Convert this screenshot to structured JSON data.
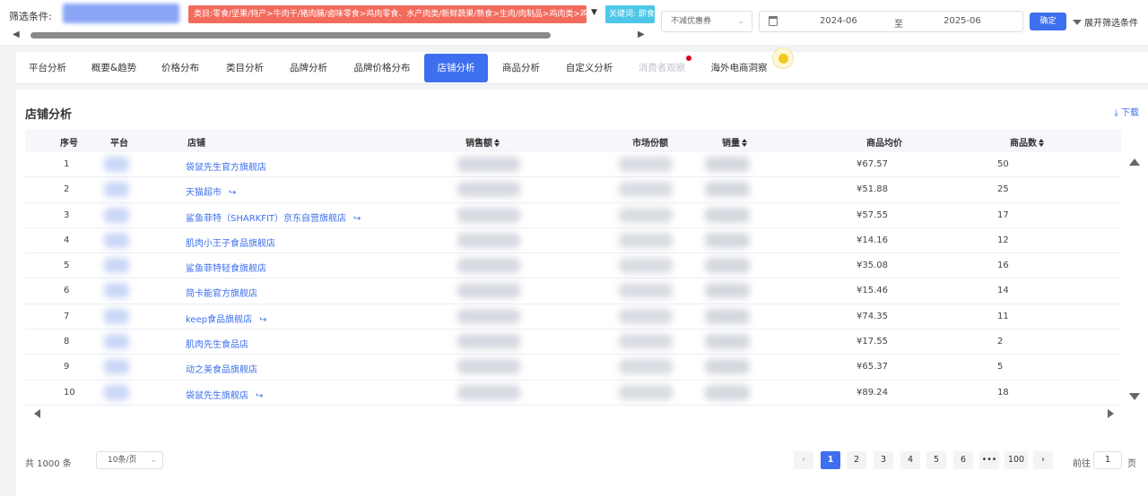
{
  "filter": {
    "label": "筛选条件:",
    "category_tag": "类目:零食/坚果/特产>牛肉干/猪肉脯/卤味零食>鸡肉零食、水产肉类/新鲜蔬果/熟食>生肉/肉制品>鸡肉类>鸡胸",
    "keyword_tag": "关键词: 即食",
    "coupon_select": "不减优惠券",
    "date_start": "2024-06",
    "date_sep": "至",
    "date_end": "2025-06",
    "confirm_label": "确定",
    "expand_label": "展开筛选条件"
  },
  "tabs": [
    {
      "label": "平台分析"
    },
    {
      "label": "概要&趋势"
    },
    {
      "label": "价格分布"
    },
    {
      "label": "类目分析"
    },
    {
      "label": "品牌分析"
    },
    {
      "label": "品牌价格分布"
    },
    {
      "label": "店铺分析"
    },
    {
      "label": "商品分析"
    },
    {
      "label": "自定义分析"
    },
    {
      "label": "消费者观察"
    },
    {
      "label": "海外电商洞察"
    }
  ],
  "panel": {
    "title": "店铺分析",
    "download_label": "下载"
  },
  "columns": {
    "index": "序号",
    "platform": "平台",
    "shop": "店铺",
    "sales": "销售额",
    "share": "市场份额",
    "volume": "销量",
    "avg_price": "商品均价",
    "count": "商品数"
  },
  "rows": [
    {
      "index": "1",
      "shop": "袋鼠先生官方旗舰店",
      "avg_price": "¥67.57",
      "count": "50"
    },
    {
      "index": "2",
      "shop": "天猫超市",
      "avg_price": "¥51.88",
      "count": "25"
    },
    {
      "index": "3",
      "shop": "鲨鱼菲特（SHARKFIT）京东自营旗舰店",
      "avg_price": "¥57.55",
      "count": "17"
    },
    {
      "index": "4",
      "shop": "肌肉小王子食品旗舰店",
      "avg_price": "¥14.16",
      "count": "12"
    },
    {
      "index": "5",
      "shop": "鲨鱼菲特轻食旗舰店",
      "avg_price": "¥35.08",
      "count": "16"
    },
    {
      "index": "6",
      "shop": "简卡能官方旗舰店",
      "avg_price": "¥15.46",
      "count": "14"
    },
    {
      "index": "7",
      "shop": "keep食品旗舰店",
      "avg_price": "¥74.35",
      "count": "11"
    },
    {
      "index": "8",
      "shop": "肌肉先生食品店",
      "avg_price": "¥17.55",
      "count": "2"
    },
    {
      "index": "9",
      "shop": "动之美食品旗舰店",
      "avg_price": "¥65.37",
      "count": "5"
    },
    {
      "index": "10",
      "shop": "袋鼠先生旗舰店",
      "avg_price": "¥89.24",
      "count": "18"
    }
  ],
  "footer": {
    "total": "共 1000 条",
    "page_size": "10条/页",
    "pages": [
      "1",
      "2",
      "3",
      "4",
      "5",
      "6",
      "•••",
      "100"
    ],
    "prev": "‹",
    "next": "›",
    "goto_label": "前往",
    "goto_value": "1",
    "goto_suffix": "页"
  },
  "colors": {
    "accent": "#3d6fee",
    "category_tag": "#f36b5d",
    "keyword_tag": "#4dc7e8",
    "notification_dot": "#d9001b"
  }
}
